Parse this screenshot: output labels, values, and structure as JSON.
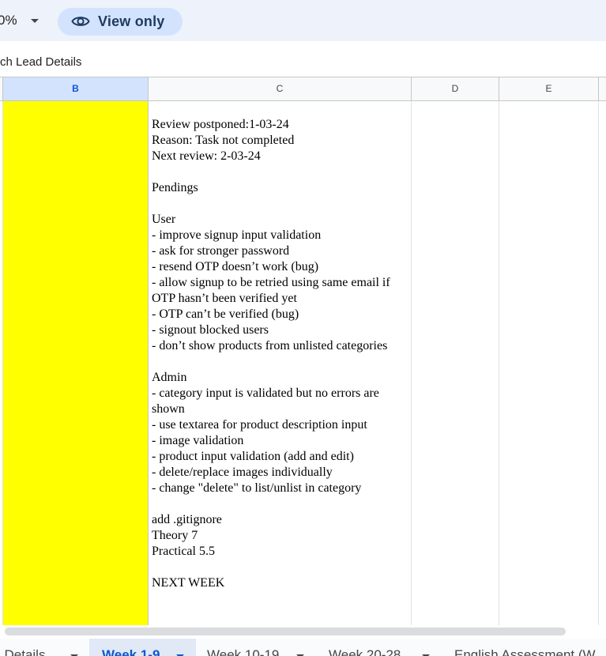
{
  "toolbar": {
    "zoom_value": "0%",
    "view_only_label": "View only"
  },
  "formula_bar": {
    "cell_content": "ch Lead Details"
  },
  "columns": [
    {
      "label": "B",
      "selected": true
    },
    {
      "label": "C",
      "selected": false
    },
    {
      "label": "D",
      "selected": false
    },
    {
      "label": "E",
      "selected": false
    }
  ],
  "cell_c_lines": [
    "Review postponed:1-03-24",
    "Reason: Task not completed",
    "Next review: 2-03-24",
    "",
    "Pendings",
    "",
    "User",
    "- improve signup input validation",
    "- ask for stronger password",
    "- resend OTP doesn’t work (bug)",
    "- allow signup to be retried using same email if",
    "OTP hasn’t been verified yet",
    "- OTP can’t be verified (bug)",
    "- signout blocked users",
    "- don’t show products from unlisted categories",
    "",
    "Admin",
    "- category input is validated but no errors are",
    "shown",
    "- use textarea for product description input",
    "- image validation",
    "- product input validation (add and edit)",
    "- delete/replace images individually",
    "- change \"delete\" to list/unlist in category",
    "",
    "add .gitignore",
    "Theory 7",
    "Practical 5.5",
    "",
    "NEXT WEEK"
  ],
  "sheet_tabs": [
    {
      "label": "l Details",
      "active": false
    },
    {
      "label": "Week 1-9",
      "active": true
    },
    {
      "label": "Week 10-19",
      "active": false
    },
    {
      "label": "Week 20-28",
      "active": false
    },
    {
      "label": "English Assessment (W",
      "active": false
    }
  ],
  "colors": {
    "highlight_yellow": "#ffff00",
    "selected_header": "#d3e3fd",
    "accent_blue": "#0b57d0"
  }
}
